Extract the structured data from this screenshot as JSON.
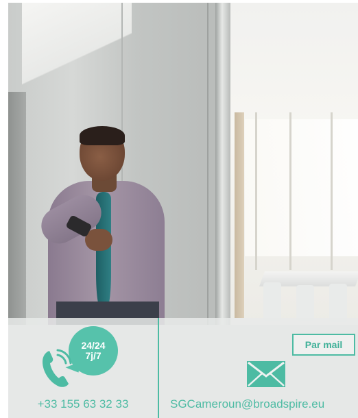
{
  "hotline": {
    "availability_line1": "24/24",
    "availability_line2": "7j/7",
    "phone_number": "+33 155 63 32 33",
    "icon": "phone-icon"
  },
  "mail": {
    "button_label": "Par mail",
    "email_address": "SGCameroun@broadspire.eu",
    "icon": "envelope-icon"
  },
  "colors": {
    "accent": "#4dbba3",
    "bubble": "#56c2ab"
  }
}
